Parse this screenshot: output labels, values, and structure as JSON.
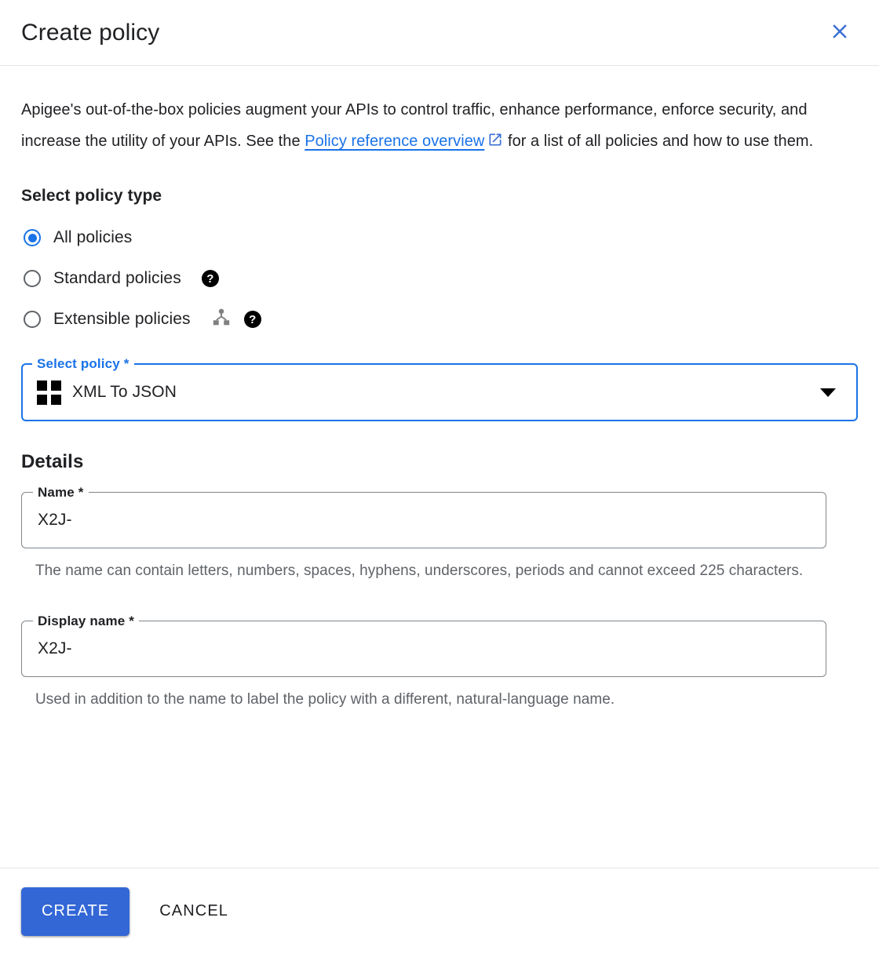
{
  "header": {
    "title": "Create policy",
    "close_icon": "close-icon"
  },
  "intro": {
    "text_before": "Apigee's out-of-the-box policies augment your APIs to control traffic, enhance performance, enforce security, and increase the utility of your APIs. See the ",
    "link_text": "Policy reference overview",
    "link_icon": "external-link-icon",
    "text_after": " for a list of all policies and how to use them."
  },
  "policy_type": {
    "heading": "Select policy type",
    "options": [
      {
        "label": "All policies",
        "selected": true,
        "help": false,
        "tree": false
      },
      {
        "label": "Standard policies",
        "selected": false,
        "help": true,
        "tree": false
      },
      {
        "label": "Extensible policies",
        "selected": false,
        "help": true,
        "tree": true
      }
    ],
    "help_glyph": "?"
  },
  "select_policy": {
    "label": "Select policy *",
    "value": "XML To JSON",
    "value_icon": "grid-view-icon",
    "dropdown_icon": "chevron-down-icon"
  },
  "details": {
    "heading": "Details",
    "name_field": {
      "label": "Name *",
      "value": "X2J-",
      "placeholder": "",
      "helper": "The name can contain letters, numbers, spaces, hyphens, underscores, periods and cannot exceed 225 characters."
    },
    "display_name_field": {
      "label": "Display name *",
      "value": "X2J-",
      "placeholder": "",
      "helper": "Used in addition to the name to label the policy with a different, natural-language name."
    }
  },
  "footer": {
    "create_label": "CREATE",
    "cancel_label": "CANCEL"
  },
  "colors": {
    "accent_blue": "#1a73e8",
    "button_blue": "#3367d6",
    "text_primary": "#202124",
    "text_secondary": "#5f6368",
    "border_gray": "#80868b",
    "divider": "#e4e6e8"
  }
}
